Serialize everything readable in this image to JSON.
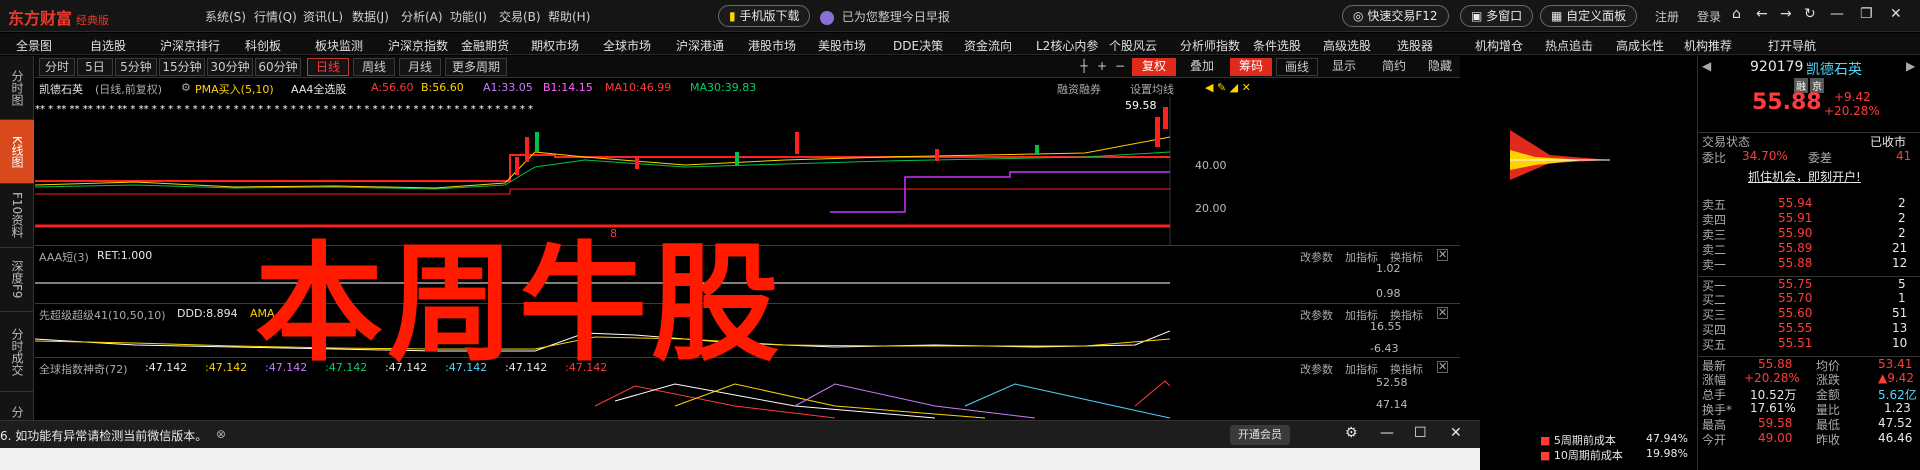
{
  "titlebar": {
    "logo": "东方财富",
    "edition": "经典版",
    "menu": [
      "系统(S)",
      "行情(Q)",
      "资讯(L)",
      "数据(J)",
      "分析(A)",
      "功能(I)",
      "交易(B)",
      "帮助(H)"
    ],
    "mobile_download": "手机版下载",
    "morning_report": "已为您整理今日早报",
    "quick_trade": "快速交易F12",
    "multi_window": "多窗口",
    "custom_panel": "自定义面板",
    "register": "注册",
    "login": "登录"
  },
  "navbar": {
    "items": [
      "全景图",
      "自选股",
      "沪深京排行",
      "科创板",
      "板块监测",
      "沪深京指数",
      "金融期货",
      "期权市场",
      "全球市场",
      "沪深港通",
      "港股市场",
      "美股市场",
      "DDE决策",
      "资金流向",
      "L2核心内参",
      "个股风云",
      "分析师指数",
      "条件选股",
      "高级选股",
      "选股器",
      "机构增仓",
      "热点追击",
      "高成长性",
      "机构推荐",
      "打开导航"
    ]
  },
  "left_tabs": [
    "分时图",
    "K线图",
    "F10资料",
    "深度F9",
    "分时成交",
    "分"
  ],
  "period_row": {
    "tabs": [
      "分时",
      "5日",
      "5分钟",
      "15分钟",
      "30分钟",
      "60分钟",
      "日线",
      "周线",
      "月线",
      "更多周期"
    ],
    "active_tab": "日线",
    "tools": [
      "复权",
      "叠加",
      "筹码",
      "画线",
      "显示",
      "简约",
      "隐藏"
    ]
  },
  "chart_header": {
    "stock_name": "凯德石英",
    "mode": "(日线,前复权)",
    "indicator": "PMA买入(5,10)",
    "indicator2": "AA4全选股",
    "a_val": "A:56.60",
    "b_val": "B:56.60",
    "a1_val": "A1:33.05",
    "b1_val": "B1:14.15",
    "ma10": "MA10:46.99",
    "ma30": "MA30:39.83",
    "right1": "融资融券",
    "right2": "设置均线"
  },
  "main_chart": {
    "price_label": "59.58",
    "axis": [
      "40.00",
      "20.00"
    ],
    "low_label": "8"
  },
  "panel1": {
    "title": "AAA短(3)",
    "ret": "RET:1.000",
    "axis": [
      "1.02",
      "0.98"
    ],
    "buttons": [
      "改参数",
      "加指标",
      "换指标"
    ]
  },
  "panel2": {
    "title": "先超级超级41(10,50,10)",
    "ddd": "DDD:8.894",
    "ama": "AMA",
    "axis": [
      "16.55",
      "-6.43"
    ],
    "buttons": [
      "改参数",
      "加指标",
      "换指标"
    ]
  },
  "panel3": {
    "title": "全球指数神奇(72)",
    "values": [
      ":47.142",
      ":47.142",
      ":47.142",
      ":47.142",
      ":47.142",
      ":47.142",
      ":47.142",
      ":47.142",
      ":47.142"
    ],
    "axis": [
      "52.58",
      "47.14"
    ],
    "buttons": [
      "改参数",
      "加指标",
      "换指标"
    ]
  },
  "overlay_text": "本周牛股",
  "notification": {
    "text": "6. 如功能有异常请检测当前微信版本。",
    "vip": "开通会员"
  },
  "cost_legend": [
    {
      "label": "5周期前成本",
      "value": "47.94%"
    },
    {
      "label": "10周期前成本",
      "value": "19.98%"
    }
  ],
  "right_panel": {
    "code": "920179",
    "name": "凯德石英",
    "tags": [
      "融",
      "京"
    ],
    "price": "55.88",
    "change": "+9.42",
    "change_pct": "+20.28%",
    "trade_status_label": "交易状态",
    "trade_status": "已收市",
    "weibi_label": "委比",
    "weibi": "34.70%",
    "weicha_label": "委差",
    "weicha": "41",
    "promo": "抓住机会，即刻开户!",
    "asks": [
      {
        "label": "卖五",
        "price": "55.94",
        "vol": "2"
      },
      {
        "label": "卖四",
        "price": "55.91",
        "vol": "2"
      },
      {
        "label": "卖三",
        "price": "55.90",
        "vol": "2"
      },
      {
        "label": "卖二",
        "price": "55.89",
        "vol": "21"
      },
      {
        "label": "卖一",
        "price": "55.88",
        "vol": "12"
      }
    ],
    "bids": [
      {
        "label": "买一",
        "price": "55.75",
        "vol": "5"
      },
      {
        "label": "买二",
        "price": "55.70",
        "vol": "1"
      },
      {
        "label": "买三",
        "price": "55.60",
        "vol": "51"
      },
      {
        "label": "买四",
        "price": "55.55",
        "vol": "13"
      },
      {
        "label": "买五",
        "price": "55.51",
        "vol": "10"
      }
    ],
    "stats": [
      {
        "l1": "最新",
        "v1": "55.88",
        "c1": "red",
        "l2": "均价",
        "v2": "53.41",
        "c2": "red"
      },
      {
        "l1": "涨幅",
        "v1": "+20.28%",
        "c1": "red",
        "l2": "涨跌",
        "v2": "▲9.42",
        "c2": "red"
      },
      {
        "l1": "总手",
        "v1": "10.52万",
        "c1": "white",
        "l2": "金额",
        "v2": "5.62亿",
        "c2": "cyan"
      },
      {
        "l1": "换手*",
        "v1": "17.61%",
        "c1": "white",
        "l2": "量比",
        "v2": "1.23",
        "c2": "white"
      },
      {
        "l1": "最高",
        "v1": "59.58",
        "c1": "red",
        "l2": "最低",
        "v2": "47.52",
        "c2": "white"
      },
      {
        "l1": "今开",
        "v1": "49.00",
        "c1": "red",
        "l2": "昨收",
        "v2": "46.46",
        "c2": "white"
      }
    ]
  }
}
